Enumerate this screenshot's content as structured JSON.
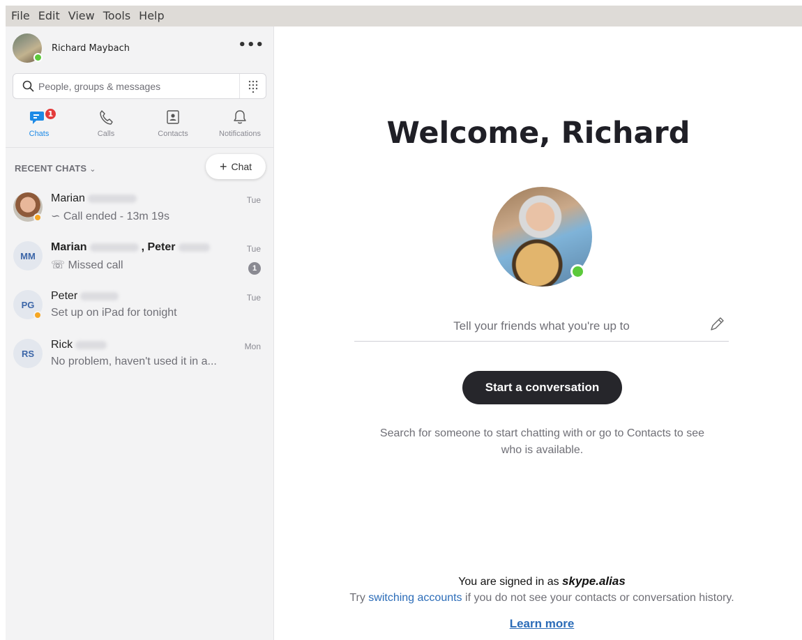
{
  "menubar": {
    "items": [
      "File",
      "Edit",
      "View",
      "Tools",
      "Help"
    ]
  },
  "profile": {
    "name": "Richard Maybach",
    "more_label": "•••",
    "presence_color": "#5cc93b"
  },
  "search": {
    "placeholder": "People, groups & messages",
    "icon": "search-icon",
    "dialpad_icon": "dialpad-icon"
  },
  "tabs": [
    {
      "label": "Chats",
      "icon": "chat-icon",
      "active": true,
      "badge": "1"
    },
    {
      "label": "Calls",
      "icon": "phone-icon",
      "active": false
    },
    {
      "label": "Contacts",
      "icon": "contacts-icon",
      "active": false
    },
    {
      "label": "Notifications",
      "icon": "bell-icon",
      "active": false
    }
  ],
  "recent": {
    "header": "RECENT CHATS",
    "new_chat_label": "Chat"
  },
  "chats": [
    {
      "name": "Marian",
      "preview": "Call ended - 13m 19s",
      "date": "Tue",
      "avatar": "photo",
      "status": "away"
    },
    {
      "name_a": "Marian",
      "name_b": ", Peter",
      "preview": "Missed call",
      "date": "Tue",
      "initials": "MM",
      "unread": "1"
    },
    {
      "name": "Peter",
      "preview": "Set up on iPad for tonight",
      "date": "Tue",
      "initials": "PG",
      "status": "away"
    },
    {
      "name": "Rick",
      "preview": "No problem, haven't used it in a...",
      "date": "Mon",
      "initials": "RS"
    }
  ],
  "main": {
    "welcome": "Welcome, Richard",
    "mood_placeholder": "Tell your friends what you're up to",
    "start_button": "Start a conversation",
    "hint": "Search for someone to start chatting with or go to Contacts to see who is available.",
    "signed_in_prefix": "You are signed in as ",
    "alias": "skype.alias",
    "try_prefix": "Try ",
    "switch_link": "switching accounts",
    "try_suffix": " if you do not see your contacts or conversation history.",
    "learn_more": "Learn more"
  },
  "colors": {
    "accent": "#1d8ae6",
    "badge": "#e33b3b",
    "away": "#f5a623",
    "link": "#2b6cb8",
    "dark_button": "#26262b"
  }
}
